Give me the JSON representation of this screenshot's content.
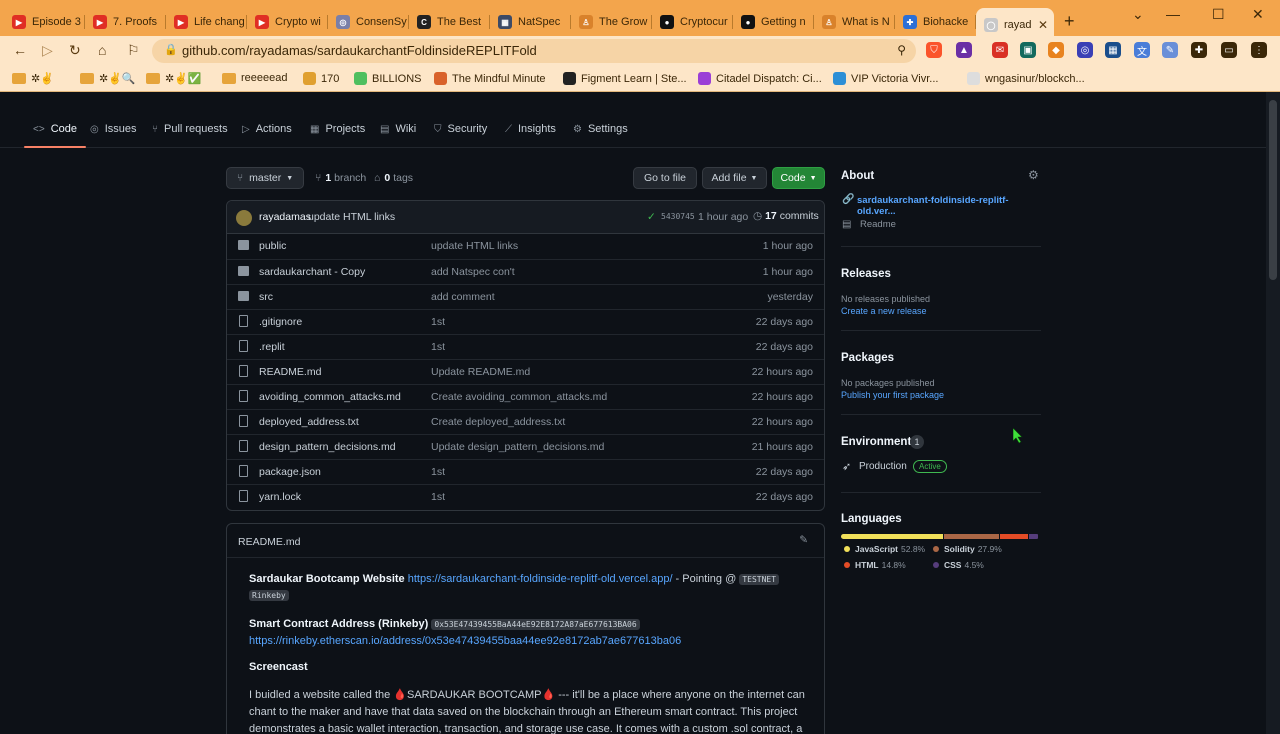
{
  "browser": {
    "tabs": [
      {
        "label": "Episode 3",
        "fav_color": "#e02e24",
        "fav_glyph": "▶"
      },
      {
        "label": "7. Proofs",
        "fav_color": "#e02e24",
        "fav_glyph": "▶"
      },
      {
        "label": "Life chang",
        "fav_color": "#e02e24",
        "fav_glyph": "▶"
      },
      {
        "label": "Crypto wi",
        "fav_color": "#e02e24",
        "fav_glyph": "▶"
      },
      {
        "label": "ConsenSy",
        "fav_color": "#7a7fa8",
        "fav_glyph": "◎"
      },
      {
        "label": "The Best",
        "fav_color": "#222222",
        "fav_glyph": "C"
      },
      {
        "label": "NatSpec",
        "fav_color": "#3c4a66",
        "fav_glyph": "▦"
      },
      {
        "label": "The Grow",
        "fav_color": "#d9822b",
        "fav_glyph": "♙"
      },
      {
        "label": "Cryptocur",
        "fav_color": "#111111",
        "fav_glyph": "●"
      },
      {
        "label": "Getting n",
        "fav_color": "#111111",
        "fav_glyph": "●"
      },
      {
        "label": "What is N",
        "fav_color": "#d9822b",
        "fav_glyph": "♙"
      },
      {
        "label": "Biohacke",
        "fav_color": "#2d6fd6",
        "fav_glyph": "✚"
      },
      {
        "label": "rayad",
        "fav_color": "#c8c8c8",
        "fav_glyph": "◯",
        "active": true
      }
    ],
    "new_tab": "+",
    "url": "github.com/rayadamas/sardaukarchantFoldinsideREPLITFold",
    "bookmarks": [
      {
        "label": "✲✌️",
        "type": "folder"
      },
      {
        "label": "✲✌️🔍",
        "type": "folder"
      },
      {
        "label": "✲✌️✅",
        "type": "folder"
      },
      {
        "label": "reeeeead",
        "type": "folder"
      },
      {
        "label": "170",
        "type": "icon",
        "color": "#e0a030"
      },
      {
        "label": "BILLIONS",
        "type": "icon",
        "color": "#4fbf5f"
      },
      {
        "label": "The Mindful Minute",
        "type": "icon",
        "color": "#d9622b"
      },
      {
        "label": "Figment Learn | Ste...",
        "type": "icon",
        "color": "#222222"
      },
      {
        "label": "Citadel Dispatch: Ci...",
        "type": "icon",
        "color": "#9b3fd6"
      },
      {
        "label": "VIP Victoria Vivr...",
        "type": "icon",
        "color": "#2d8fd6"
      },
      {
        "label": "wngasinur/blockch...",
        "type": "icon",
        "color": "#dddddd"
      }
    ]
  },
  "repo_nav": {
    "tabs": [
      {
        "label": "Code",
        "icon": "<>",
        "active": true
      },
      {
        "label": "Issues",
        "icon": "◎"
      },
      {
        "label": "Pull requests",
        "icon": "⑂"
      },
      {
        "label": "Actions",
        "icon": "▷"
      },
      {
        "label": "Projects",
        "icon": "▦"
      },
      {
        "label": "Wiki",
        "icon": "▤"
      },
      {
        "label": "Security",
        "icon": "⛉"
      },
      {
        "label": "Insights",
        "icon": "⟋"
      },
      {
        "label": "Settings",
        "icon": "⚙"
      }
    ]
  },
  "branch_bar": {
    "branch": "master",
    "branches_count": "1",
    "branches_label": "branch",
    "tags_count": "0",
    "tags_label": "tags",
    "go_to_file": "Go to file",
    "add_file": "Add file",
    "code": "Code"
  },
  "commit": {
    "author": "rayadamas",
    "message": "update HTML links",
    "hash": "5430745",
    "time": "1 hour ago",
    "commits_count": "17",
    "commits_label": "commits"
  },
  "files": [
    {
      "name": "public",
      "type": "dir",
      "message": "update HTML links",
      "time": "1 hour ago"
    },
    {
      "name": "sardaukarchant - Copy",
      "type": "dir",
      "message": "add Natspec con't",
      "time": "1 hour ago"
    },
    {
      "name": "src",
      "type": "dir",
      "message": "add comment",
      "time": "yesterday"
    },
    {
      "name": ".gitignore",
      "type": "file",
      "message": "1st",
      "time": "22 days ago"
    },
    {
      "name": ".replit",
      "type": "file",
      "message": "1st",
      "time": "22 days ago"
    },
    {
      "name": "README.md",
      "type": "file",
      "message": "Update README.md",
      "time": "22 hours ago"
    },
    {
      "name": "avoiding_common_attacks.md",
      "type": "file",
      "message": "Create avoiding_common_attacks.md",
      "time": "22 hours ago"
    },
    {
      "name": "deployed_address.txt",
      "type": "file",
      "message": "Create deployed_address.txt",
      "time": "22 hours ago"
    },
    {
      "name": "design_pattern_decisions.md",
      "type": "file",
      "message": "Update design_pattern_decisions.md",
      "time": "21 hours ago"
    },
    {
      "name": "package.json",
      "type": "file",
      "message": "1st",
      "time": "22 days ago"
    },
    {
      "name": "yarn.lock",
      "type": "file",
      "message": "1st",
      "time": "22 days ago"
    }
  ],
  "readme": {
    "title": "README.md",
    "line1_bold": "Sardaukar Bootcamp Website",
    "line1_link": "https://sardaukarchant-foldinside-replitf-old.vercel.app/",
    "line1_rest": " - Pointing @ ",
    "line1_code": "TESTNET",
    "line1b_code": "Rinkeby",
    "line2_bold": "Smart Contract Address (Rinkeby)",
    "line2_code": "0x53E47439455BaA44eE92E8172A87aE677613BA06",
    "line2_link": "https://rinkeby.etherscan.io/address/0x53e47439455baa44ee92e8172ab7ae677613ba06",
    "screencast": "Screencast",
    "para1": "I buidled a website called the 🩸SARDAUKAR BOOTCAMP🩸 --- it'll be a place where anyone on the internet can",
    "para2": "chant to the maker and have that data saved on the blockchain through an Ethereum smart contract. This project",
    "para3": "demonstrates a basic wallet interaction, transaction, and storage use case. It comes with a custom .sol contract, a"
  },
  "about": {
    "title": "About",
    "link": "sardaukarchant-foldinside-replitf-old.ver...",
    "readme": "Readme"
  },
  "releases": {
    "title": "Releases",
    "empty": "No releases published",
    "create": "Create a new release"
  },
  "packages": {
    "title": "Packages",
    "empty": "No packages published",
    "publish": "Publish your first package"
  },
  "environments": {
    "title": "Environments",
    "count": "1",
    "name": "Production",
    "status": "Active"
  },
  "languages": {
    "title": "Languages",
    "items": [
      {
        "name": "JavaScript",
        "percent": "52.8%",
        "value": 52.8,
        "color": "#f1e05a"
      },
      {
        "name": "Solidity",
        "percent": "27.9%",
        "value": 27.9,
        "color": "#aa6746"
      },
      {
        "name": "HTML",
        "percent": "14.8%",
        "value": 14.8,
        "color": "#e34c26"
      },
      {
        "name": "CSS",
        "percent": "4.5%",
        "value": 4.5,
        "color": "#563d7c"
      }
    ]
  }
}
